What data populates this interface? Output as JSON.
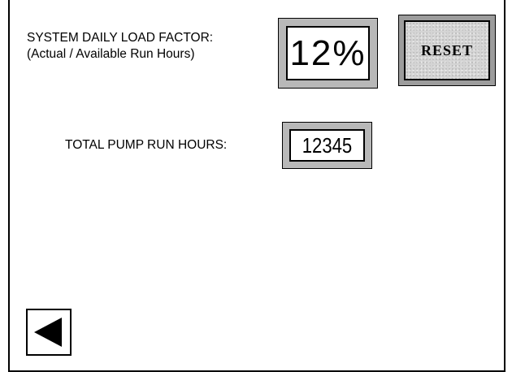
{
  "load_factor": {
    "label_line1": "SYSTEM DAILY LOAD FACTOR:",
    "label_line2": "(Actual / Available Run Hours)",
    "value": "12%"
  },
  "reset_button": {
    "label": "RESET"
  },
  "pump_hours": {
    "label": "TOTAL PUMP RUN HOURS:",
    "value": "12345"
  },
  "navigation": {
    "back_icon": "left-triangle-arrow"
  }
}
